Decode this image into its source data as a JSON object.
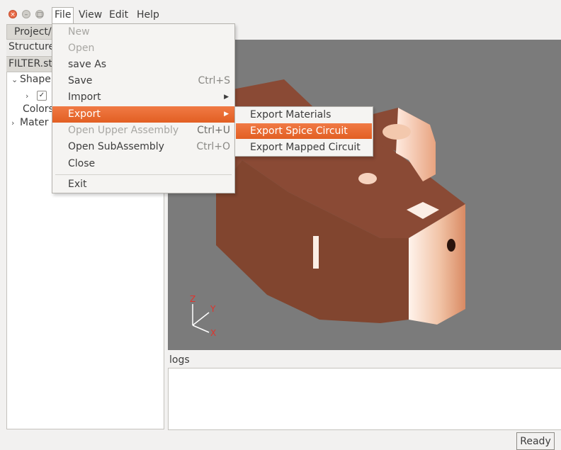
{
  "menubar": {
    "window_controls": [
      "close-icon",
      "minimize-icon",
      "maximize-icon"
    ],
    "items": [
      "File",
      "View",
      "Edit",
      "Help"
    ]
  },
  "left_panel": {
    "tab_label": "Project/",
    "header": "Structure",
    "file_tab": "FILTER.st",
    "tree": {
      "shapes": "Shape",
      "colors": "Colors",
      "materials": "Mater"
    }
  },
  "file_menu": {
    "items": [
      {
        "label": "New",
        "shortcut": "",
        "enabled": false
      },
      {
        "label": "Open",
        "shortcut": "",
        "enabled": false
      },
      {
        "label": "save As",
        "shortcut": "",
        "enabled": true
      },
      {
        "label": "Save",
        "shortcut": "Ctrl+S",
        "enabled": true
      },
      {
        "label": "Import",
        "shortcut": "",
        "enabled": true,
        "submenu": true
      },
      {
        "label": "Export",
        "shortcut": "",
        "enabled": true,
        "submenu": true,
        "active": true
      },
      {
        "label": "Open Upper Assembly",
        "shortcut": "Ctrl+U",
        "enabled": false
      },
      {
        "label": "Open SubAssembly",
        "shortcut": "Ctrl+O",
        "enabled": true
      },
      {
        "label": "Close",
        "shortcut": "",
        "enabled": true
      },
      {
        "label": "Exit",
        "shortcut": "",
        "enabled": true
      }
    ]
  },
  "export_submenu": {
    "items": [
      {
        "label": "Export Materials",
        "active": false
      },
      {
        "label": "Export Spice Circuit",
        "active": true
      },
      {
        "label": "Export Mapped Circuit",
        "active": false
      }
    ]
  },
  "viewport": {
    "axes": {
      "z": "Z",
      "y": "Y",
      "x": "X"
    },
    "colors": {
      "background": "#7b7b7b",
      "model": "#8a4a35",
      "axis": "#e0332c"
    }
  },
  "logs": {
    "label": "logs",
    "content": ""
  },
  "status": {
    "text": "Ready"
  },
  "colors": {
    "menu_highlight": "#ea6b33",
    "window_bg": "#f2f1f0"
  }
}
